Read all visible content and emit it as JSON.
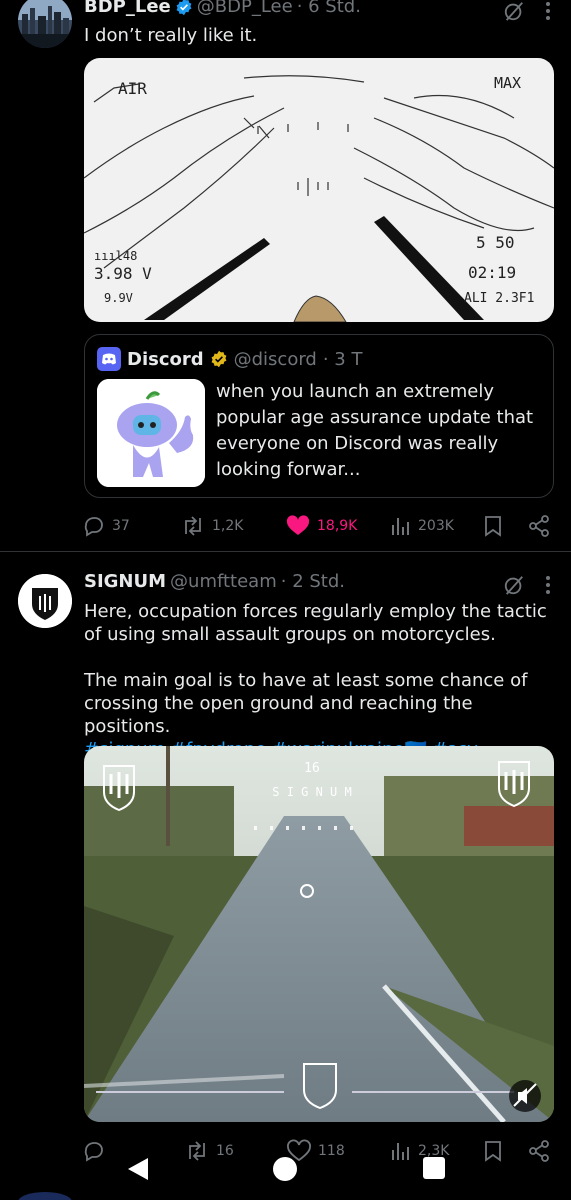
{
  "post1": {
    "name": "BDP_Lee",
    "handle": "@BDP_Lee",
    "time": "· 6 Std.",
    "text": "I don’t really like it.",
    "sketch": {
      "labels": [
        "AIR",
        "MAX",
        "ıııl48",
        "3.98 V",
        "9.9V",
        "5  50",
        "02:19",
        "ALI 2.3F1"
      ]
    },
    "quote": {
      "name": "Discord",
      "handle": "@discord",
      "time": "· 3 T",
      "text": "when you launch an extremely popular age assurance update that everyone on Discord was really looking forwar..."
    },
    "actions": {
      "replies": "37",
      "reposts": "1,2K",
      "likes": "18,9K",
      "views": "203K"
    }
  },
  "post2": {
    "name": "SIGNUM",
    "handle": "@umftteam",
    "time": "· 2 Std.",
    "text_line1": "Here, occupation forces regularly employ the tactic of using small assault groups on motorcycles.",
    "text_line2": "The main goal is to have at least some chance of crossing the open ground and reaching the positions.",
    "hashtags": "#signum #fpvdrone #warinukraine🇺🇦 #зсу",
    "video_overlay": {
      "top": "16",
      "brand": "S I G N U M"
    },
    "actions": {
      "replies": "",
      "reposts": "16",
      "likes": "118",
      "views": "2,3K"
    }
  },
  "colors": {
    "accent": "#1d9bf0",
    "like": "#f91880",
    "muted": "#71767b",
    "gold": "#e2b719"
  },
  "icons": [
    "verified-icon",
    "grok-icon",
    "more-icon",
    "reply-icon",
    "repost-icon",
    "heart-icon",
    "views-icon",
    "bookmark-icon",
    "share-icon",
    "mute-icon",
    "back-icon",
    "home-icon",
    "recents-icon"
  ]
}
